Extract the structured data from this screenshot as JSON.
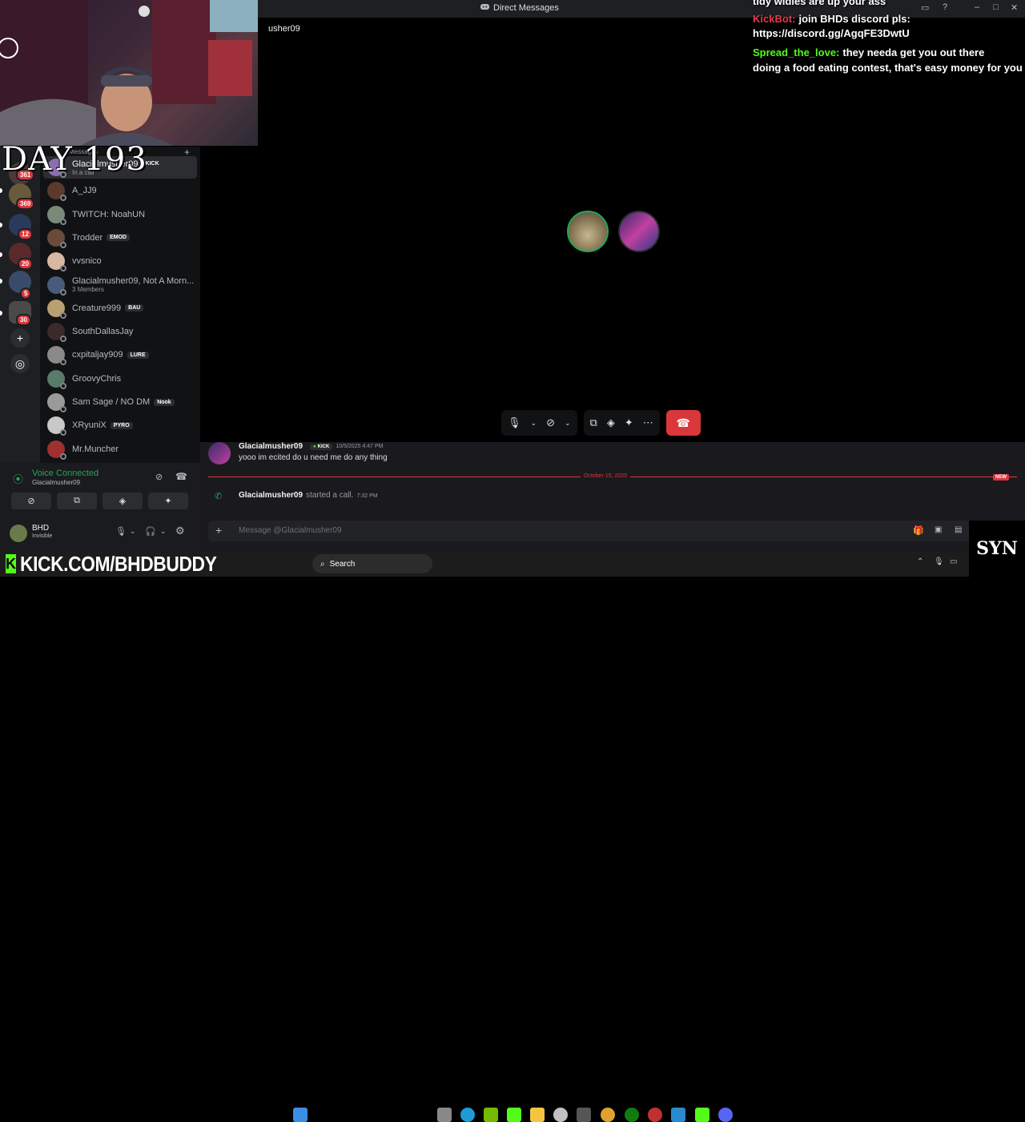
{
  "window": {
    "title": "Direct Messages"
  },
  "dm_header": {
    "partial_name": "usher09",
    "section_label": "Messages",
    "add_symbol": "+"
  },
  "sidebar": {
    "dms": [
      {
        "name": "Glacialmusher09",
        "tag": "KICK",
        "sub": "In a call",
        "color": "#8a6fb0"
      },
      {
        "name": "A_JJ9",
        "tag": "",
        "sub": "",
        "color": "#5a3a2a"
      },
      {
        "name": "TWITCH: NoahUN",
        "tag": "",
        "sub": "",
        "color": "#7a8a7a"
      },
      {
        "name": "Trodder",
        "tag": "EMOD",
        "sub": "",
        "color": "#6a4a3a"
      },
      {
        "name": "vvsnico",
        "tag": "",
        "sub": "",
        "color": "#d8b8a0"
      },
      {
        "name": "Glacialmusher09, Not A Morn...",
        "tag": "",
        "sub": "3 Members",
        "color": "#4a5a7a"
      },
      {
        "name": "Creature999",
        "tag": "BAU",
        "sub": "",
        "color": "#b8a070"
      },
      {
        "name": "SouthDallasJay",
        "tag": "",
        "sub": "",
        "color": "#3a2a2a"
      },
      {
        "name": "cxpitaljay909",
        "tag": "LURE",
        "sub": "",
        "color": "#8a8a8a"
      },
      {
        "name": "GroovyChris",
        "tag": "",
        "sub": "",
        "color": "#5a7a6a"
      },
      {
        "name": "Sam Sage / NO DM",
        "tag": "Nook",
        "sub": "",
        "color": "#9a9a9a"
      },
      {
        "name": "XRyuniX",
        "tag": "PYRO",
        "sub": "",
        "color": "#c8c8c8"
      },
      {
        "name": "Mr.Muncher",
        "tag": "",
        "sub": "",
        "color": "#a03030"
      }
    ]
  },
  "rail": {
    "badges": [
      "361",
      "369",
      "12",
      "20",
      "5",
      "30"
    ]
  },
  "voice": {
    "status": "Voice Connected",
    "channel": "Glacialmusher09",
    "user_name": "BHD",
    "user_status": "Invisible"
  },
  "chat": {
    "message": {
      "author": "Glacialmusher09",
      "tag": "KICK",
      "time": "10/5/2025 4:47 PM",
      "text": "yooo im ecited do u need me do any thing"
    },
    "divider_date": "October 15, 2025",
    "new_label": "NEW",
    "system": {
      "author": "Glacialmusher09",
      "text": "started a call.",
      "time": "7:32 PM"
    },
    "composer_placeholder": "Message @Glacialmusher09"
  },
  "overlay": {
    "day_label": "DAY 193",
    "chat_lines": [
      {
        "user": "",
        "text": "tidy widies are up your ass",
        "user_color": "#ffffff"
      },
      {
        "user": "KickBot:",
        "text": "join BHDs discord pls:",
        "user_color": "#e8384f"
      },
      {
        "user": "",
        "text": "https://discord.gg/AgqFE3DwtU",
        "user_color": "#ffffff"
      },
      {
        "user": "Spread_the_love:",
        "text": "they needa get you out there",
        "user_color": "#53fc18"
      },
      {
        "user": "",
        "text": "doing a food eating contest, that's easy money for you",
        "user_color": "#ffffff"
      }
    ],
    "stream_url": "KICK.COM/BHDBUDDY",
    "kick_letter": "K",
    "corner_logo": "SYN"
  },
  "taskbar": {
    "search_label": "Search"
  },
  "colors": {
    "accent_green": "#23a55a",
    "danger_red": "#da373c",
    "kick_green": "#53fc18"
  }
}
